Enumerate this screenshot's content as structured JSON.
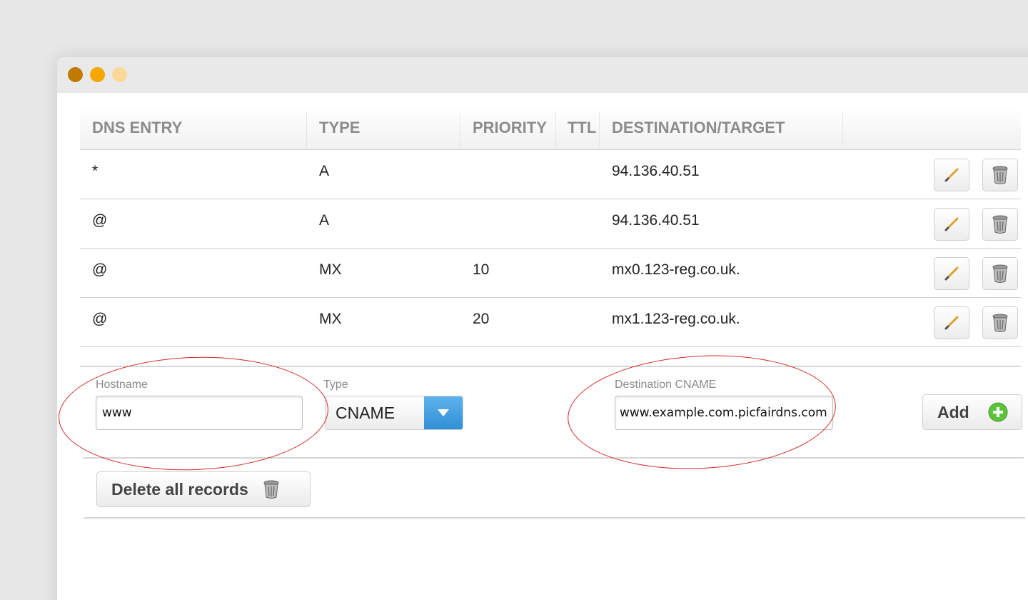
{
  "window": {
    "dots": [
      "#c07a00",
      "#f5a700",
      "#fbd89a"
    ]
  },
  "table": {
    "headers": {
      "entry": "DNS ENTRY",
      "type": "TYPE",
      "priority": "PRIORITY",
      "ttl": "TTL",
      "destination": "DESTINATION/TARGET"
    },
    "rows": [
      {
        "entry": "*",
        "type": "A",
        "priority": "",
        "ttl": "",
        "destination": "94.136.40.51"
      },
      {
        "entry": "@",
        "type": "A",
        "priority": "",
        "ttl": "",
        "destination": "94.136.40.51"
      },
      {
        "entry": "@",
        "type": "MX",
        "priority": "10",
        "ttl": "",
        "destination": "mx0.123-reg.co.uk."
      },
      {
        "entry": "@",
        "type": "MX",
        "priority": "20",
        "ttl": "",
        "destination": "mx1.123-reg.co.uk."
      }
    ],
    "row_actions": {
      "edit_icon": "pencil-icon",
      "delete_icon": "trash-icon"
    }
  },
  "form": {
    "hostname": {
      "label": "Hostname",
      "value": "www"
    },
    "type": {
      "label": "Type",
      "value": "CNAME"
    },
    "destination": {
      "label": "Destination CNAME",
      "value": "www.example.com.picfairdns.com"
    },
    "add_label": "Add",
    "add_icon": "plus-circle-icon"
  },
  "delete_all": {
    "label": "Delete all records",
    "icon": "trash-icon"
  },
  "colors": {
    "annotation": "#d32727",
    "select_arrow": "#2f8fd6",
    "add_icon": "#5cc43c",
    "edit_icon": "#e0a030"
  }
}
